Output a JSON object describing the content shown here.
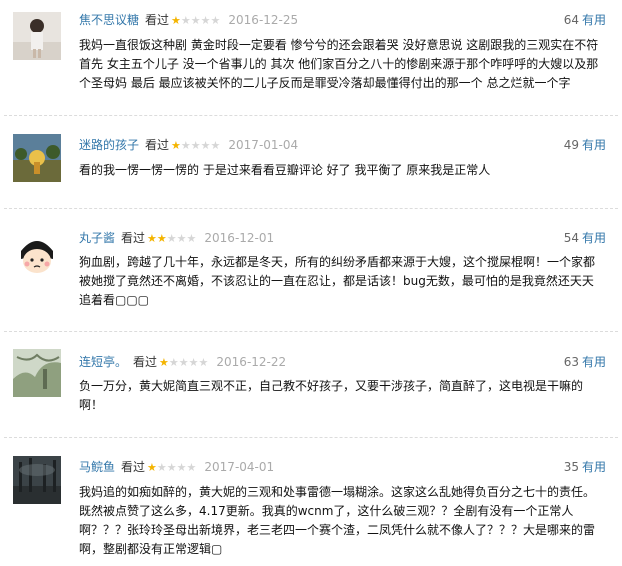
{
  "reviews": [
    {
      "user": "焦不思议糖",
      "watched": "看过",
      "rating": 1,
      "date": "2016-12-25",
      "votes": "64",
      "useful_label": "有用",
      "content": "我妈一直很饭这种剧 黄金时段一定要看 惨兮兮的还会跟着哭 没好意思说 这剧跟我的三观实在不符 首先 女主五个儿子 没一个省事儿的 其次 他们家百分之八十的惨剧来源于那个咋呼呼的大嫂以及那个圣母妈 最后 最应该被关怀的二儿子反而是罪受冷落却最懂得付出的那一个 总之烂就一个字"
    },
    {
      "user": "迷路的孩子",
      "watched": "看过",
      "rating": 1,
      "date": "2017-01-04",
      "votes": "49",
      "useful_label": "有用",
      "content": "看的我一愣一愣一愣的 于是过来看看豆瓣评论 好了 我平衡了 原来我是正常人"
    },
    {
      "user": "丸子酱",
      "watched": "看过",
      "rating": 2,
      "date": "2016-12-01",
      "votes": "54",
      "useful_label": "有用",
      "content": "狗血剧，跨越了几十年，永远都是冬天，所有的纠纷矛盾都来源于大嫂，这个搅屎棍啊！一个家都被她搅了竟然还不离婚，不该忍让的一直在忍让，都是话该！bug无数，最可怕的是我竟然还天天追着看▢▢▢"
    },
    {
      "user": "连短亭。",
      "watched": "看过",
      "rating": 1,
      "date": "2016-12-22",
      "votes": "63",
      "useful_label": "有用",
      "content": "负一万分，黄大妮简直三观不正，自己教不好孩子，又要干涉孩子，简直醉了，这电视是干嘛的啊！"
    },
    {
      "user": "马鲩鱼",
      "watched": "看过",
      "rating": 1,
      "date": "2017-04-01",
      "votes": "35",
      "useful_label": "有用",
      "content": "我妈追的如痴如醉的，黄大妮的三观和处事雷德一塌糊涂。这家这么乱她得负百分之七十的责任。既然被点赞了这么多，4.17更新。我真的wcnm了，这什么破三观？？全剧有没有一个正常人啊？？？张玲玲圣母出新境界，老三老四一个赛个渣，二凤凭什么就不像人了？？？大是哪来的雷啊，整剧都没有正常逻辑▢"
    }
  ],
  "colors": {
    "link": "#3377aa",
    "star_on": "#f4b400",
    "star_off": "#d6d6d6",
    "date": "#aaaaaa"
  },
  "icons": {
    "star_filled": "star-filled-icon",
    "star_empty": "star-empty-icon"
  }
}
